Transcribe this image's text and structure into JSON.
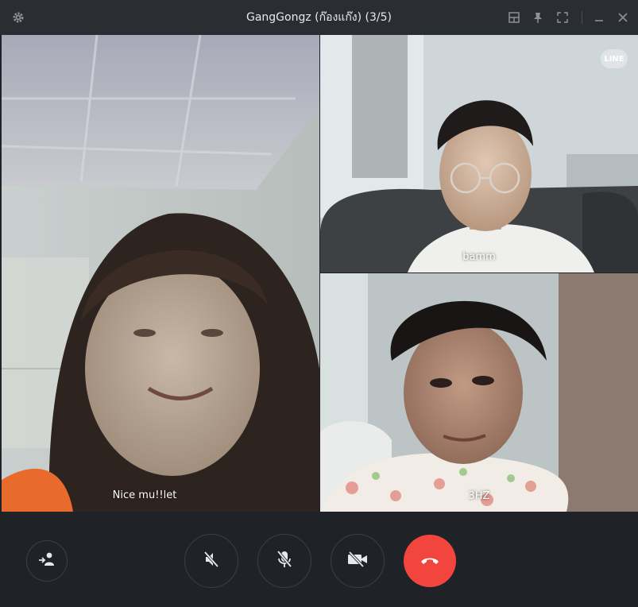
{
  "window": {
    "title": "GangGongz (ก๊องแก๊ง) (3/5)",
    "icons": [
      "gear-icon",
      "layout-icon",
      "pin-icon",
      "fullscreen-icon",
      "minimize-icon",
      "close-icon"
    ]
  },
  "participants": [
    {
      "name": "Nice mu!!let"
    },
    {
      "name": "bamm"
    },
    {
      "name": "3HZ"
    }
  ],
  "branding": {
    "logo_text": "LINE"
  },
  "controls": {
    "icons": [
      "screen-share-icon",
      "speaker-muted-icon",
      "mic-muted-icon",
      "camera-off-icon",
      "end-call-icon"
    ],
    "end_call_color": "#f2453d"
  }
}
